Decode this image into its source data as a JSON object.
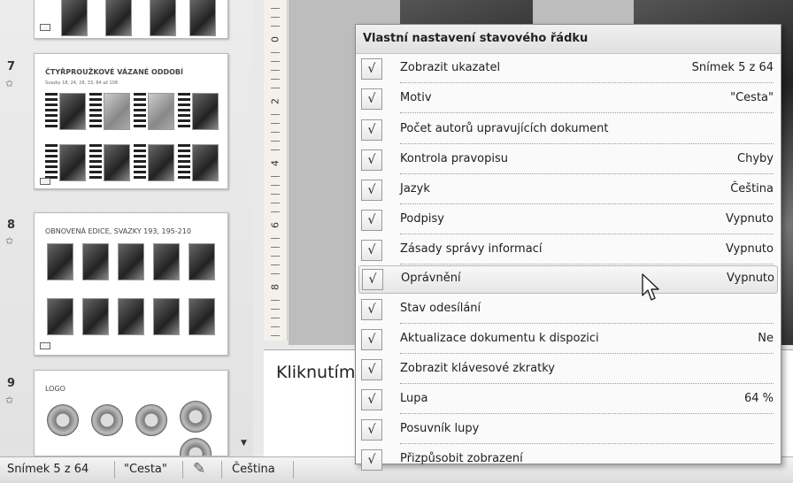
{
  "slides": [
    {
      "number": "7",
      "title": "ČTYŘPROUŽKOVÉ VÁZANÉ ODDOBÍ",
      "subtitle": "Svazky 18, 24, 28, 33, 84 až 108"
    },
    {
      "number": "8",
      "title": "OBNOVENÁ EDICE, SVAZKY 193, 195-210"
    },
    {
      "number": "9",
      "title": "LOGO"
    }
  ],
  "ruler_numbers": [
    "0",
    "2",
    "4",
    "6",
    "8"
  ],
  "notes": {
    "text": "Kliknutím"
  },
  "statusbar": {
    "slide_indicator": "Snímek 5 z 64",
    "theme": "\"Cesta\"",
    "language": "Čeština"
  },
  "menu": {
    "title": "Vlastní nastavení stavového řádku",
    "check_mark": "√",
    "items": [
      {
        "label": "Zobrazit ukazatel",
        "value": "Snímek 5 z 64"
      },
      {
        "label": "Motiv",
        "value": "\"Cesta\""
      },
      {
        "label": "Počet autorů upravujících dokument",
        "value": ""
      },
      {
        "label": "Kontrola pravopisu",
        "value": "Chyby"
      },
      {
        "label": "Jazyk",
        "value": "Čeština"
      },
      {
        "label": "Podpisy",
        "value": "Vypnuto"
      },
      {
        "label": "Zásady správy informací",
        "value": "Vypnuto"
      },
      {
        "label": "Oprávnění",
        "value": "Vypnuto"
      },
      {
        "label": "Stav odesílání",
        "value": ""
      },
      {
        "label": "Aktualizace dokumentu k dispozici",
        "value": "Ne"
      },
      {
        "label": "Zobrazit klávesové zkratky",
        "value": ""
      },
      {
        "label": "Lupa",
        "value": "64 %"
      },
      {
        "label": "Posuvník lupy",
        "value": ""
      },
      {
        "label": "Přizpůsobit zobrazení",
        "value": ""
      }
    ]
  }
}
